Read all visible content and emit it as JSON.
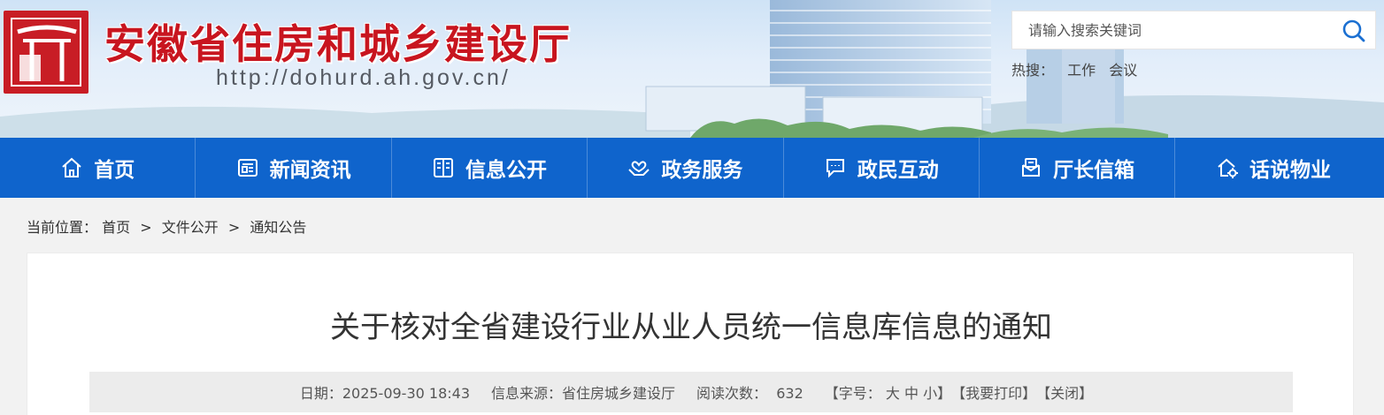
{
  "header": {
    "site_title": "安徽省住房和城乡建设厅",
    "site_url": "http://dohurd.ah.gov.cn/",
    "search_placeholder": "请输入搜索关键词",
    "hot_label": "热搜：",
    "hot_keywords": [
      "工作",
      "会议"
    ]
  },
  "nav": {
    "items": [
      {
        "label": "首页",
        "icon": "home-icon"
      },
      {
        "label": "新闻资讯",
        "icon": "news-icon"
      },
      {
        "label": "信息公开",
        "icon": "book-icon"
      },
      {
        "label": "政务服务",
        "icon": "service-hands-icon"
      },
      {
        "label": "政民互动",
        "icon": "chat-icon"
      },
      {
        "label": "厅长信箱",
        "icon": "mailbox-icon"
      },
      {
        "label": "话说物业",
        "icon": "house-gear-icon"
      }
    ]
  },
  "breadcrumb": {
    "prefix": "当前位置：",
    "items": [
      "首页",
      "文件公开",
      "通知公告"
    ],
    "separator": ">"
  },
  "article": {
    "title": "关于核对全省建设行业从业人员统一信息库信息的通知",
    "date_label": "日期：",
    "date": "2025-09-30 18:43",
    "source_label": "信息来源：",
    "source": "省住房城乡建设厅",
    "views_label": "阅读次数：",
    "views": "632",
    "font_size_prefix": "【字号：",
    "font_large": "大",
    "font_medium": "中",
    "font_small": "小",
    "font_size_suffix": "】",
    "print": "【我要打印】",
    "close": "【关闭】"
  },
  "colors": {
    "brand_red": "#c8151f",
    "nav_blue": "#0f64cc",
    "search_icon": "#1a6fd1"
  }
}
